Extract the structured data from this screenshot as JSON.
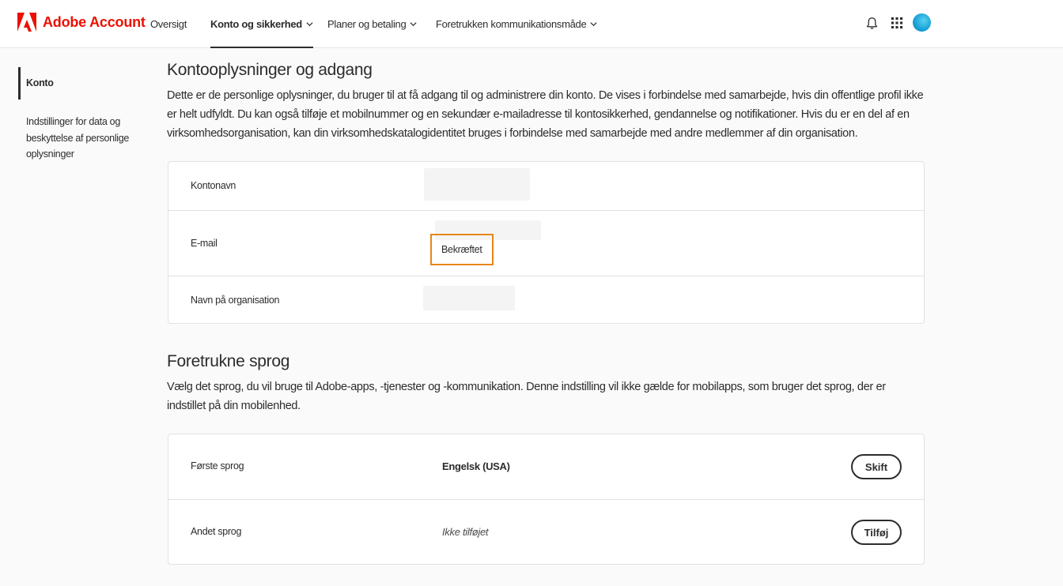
{
  "header": {
    "brand": "Adobe Account",
    "nav": [
      {
        "label": "Oversigt"
      },
      {
        "label": "Konto og sikkerhed"
      },
      {
        "label": "Planer og betaling"
      },
      {
        "label": "Foretrukken kommunikationsmåde"
      }
    ],
    "icons": [
      "bell-icon",
      "apps-grid-icon",
      "avatar"
    ]
  },
  "sidebar": {
    "items": [
      {
        "label": "Konto"
      },
      {
        "label_lines": [
          "Indstillinger for data og",
          "beskyttelse af personlige",
          "oplysninger"
        ]
      }
    ]
  },
  "account_section": {
    "title": "Kontooplysninger og adgang",
    "description": "Dette er de personlige oplysninger, du bruger til at få adgang til og administrere din konto. De vises i forbindelse med samarbejde, hvis din offentlige profil ikke er helt udfyldt. Du kan også tilføje et mobilnummer og en sekundær e-mailadresse til kontosikkerhed, gendannelse og notifikationer. Hvis du er en del af en virksomhedsorganisation, kan din virksomhedskatalogidentitet bruges i forbindelse med samarbejde med andre medlemmer af din organisation.",
    "rows": [
      {
        "label": "Kontonavn"
      },
      {
        "label": "E-mail",
        "status": "Bekræftet"
      },
      {
        "label": "Navn på organisation"
      }
    ]
  },
  "language_section": {
    "title": "Foretrukne sprog",
    "description": "Vælg det sprog, du vil bruge til Adobe-apps, -tjenester og -kommunikation. Denne indstilling vil ikke gælde for mobilapps, som bruger det sprog, der er indstillet på din mobilenhed.",
    "rows": [
      {
        "label": "Første sprog",
        "value": "Engelsk (USA)",
        "action": "Skift"
      },
      {
        "label": "Andet sprog",
        "value": "Ikke tilføjet",
        "action": "Tilføj"
      }
    ]
  },
  "colors": {
    "adobe_red": "#eb1000",
    "highlight_orange": "#e68619"
  }
}
